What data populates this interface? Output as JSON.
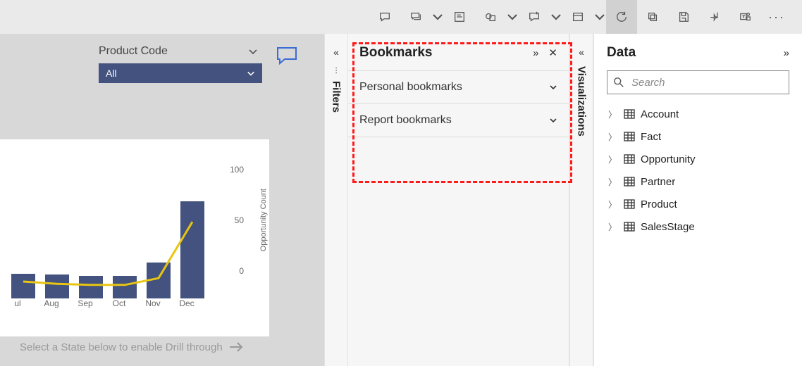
{
  "toolbar_icons": [
    "chat",
    "chat-reply",
    "caret",
    "doc",
    "shapes",
    "caret",
    "chat-add",
    "caret",
    "window",
    "caret",
    "refresh",
    "windows",
    "save",
    "pin",
    "teams",
    "more"
  ],
  "slicer": {
    "title": "Product Code",
    "value": "All"
  },
  "chart_data": {
    "type": "bar+line",
    "categories": [
      "ul",
      "Aug",
      "Sep",
      "Oct",
      "Nov",
      "Dec"
    ],
    "bar_values": [
      22,
      21,
      20,
      20,
      32,
      86
    ],
    "line_values": [
      15,
      13,
      12,
      12,
      18,
      68
    ],
    "ylabel": "Opportunity Count",
    "yticks": [
      0,
      50,
      100
    ],
    "ylim": [
      0,
      100
    ]
  },
  "drill_hint": "Select a State below to enable Drill through",
  "filters": {
    "label": "Filters"
  },
  "bookmarks": {
    "title": "Bookmarks",
    "sections": [
      {
        "label": "Personal bookmarks"
      },
      {
        "label": "Report bookmarks"
      }
    ]
  },
  "visualizations": {
    "label": "Visualizations"
  },
  "data_panel": {
    "title": "Data",
    "search_placeholder": "Search",
    "tables": [
      "Account",
      "Fact",
      "Opportunity",
      "Partner",
      "Product",
      "SalesStage"
    ]
  }
}
